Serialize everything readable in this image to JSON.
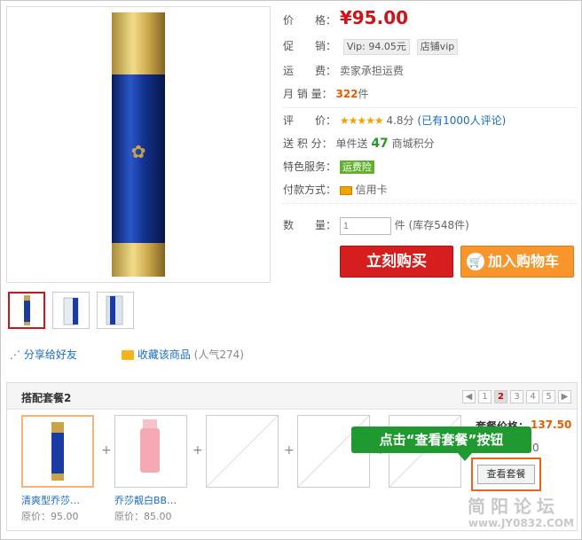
{
  "product": {
    "price_label": "价　　格：",
    "price": "¥95.00",
    "promo_label": "促　　销：",
    "promo_tag1": "Vip: 94.05元",
    "promo_tag2": "店铺vip",
    "shipping_label": "运　　费：",
    "shipping_value": "卖家承担运费",
    "sales_label": "月 销 量：",
    "sales_value": "322",
    "sales_unit": "件",
    "rating_label": "评　　价：",
    "rating_stars": "★★★★★",
    "rating_score": "4.8分",
    "rating_count": "(已有1000人评论)",
    "points_label": "送 积 分：",
    "points_prefix": "单件送",
    "points_value": "47",
    "points_suffix": "商城积分",
    "service_label": "特色服务：",
    "service_badge": "运费险",
    "payment_label": "付款方式：",
    "payment_value": "信用卡",
    "qty_label": "数　　量：",
    "qty_value": "1",
    "qty_unit": "件",
    "stock": "(库存548件)",
    "buy_label": "立刻购买",
    "cart_label": "加入购物车"
  },
  "gallery": {
    "thumb_count": 3
  },
  "links": {
    "share": "分享给好友",
    "favorite": "收藏该商品",
    "popularity": "(人气274)"
  },
  "combo": {
    "title": "搭配套餐2",
    "pager": [
      "◀",
      "1",
      "2",
      "3",
      "4",
      "5",
      "▶"
    ],
    "pager_current": "2",
    "items": [
      {
        "name": "清爽型乔莎…",
        "price": "原价：95.00"
      },
      {
        "name": "乔莎靓白BB…",
        "price": "原价：85.00"
      }
    ],
    "price_label": "套餐价格：",
    "price_value": "137.50",
    "saving_fragment": "0",
    "view_button": "查看套餐",
    "callout": "点击“查看套餐”按钮"
  },
  "watermark": {
    "text": "简阳论坛",
    "url": "www.JY0832.COM"
  },
  "colors": {
    "price_red": "#d0121b",
    "buy_button": "#d61e1e",
    "cart_button": "#f8952b",
    "callout_green": "#1e9a30",
    "highlight_orange": "#e8671e",
    "link_blue": "#1a6bc2"
  }
}
